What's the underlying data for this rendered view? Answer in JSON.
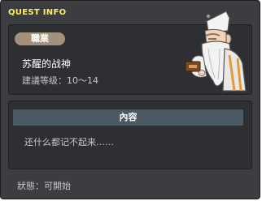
{
  "quest": {
    "id": "29924-0",
    "window_title": "QUEST INFO",
    "job_badge": "職業",
    "name": "苏醒的战神",
    "level_requirement": "建議等级：10～14",
    "content_header": "內容",
    "content_text": "还什么都记不起来……",
    "status": "狀態：可開始"
  },
  "colors": {
    "window_bg": "#3b3d40",
    "card_bg": "#2d2f33",
    "title": "#ffee66",
    "badge": "#a4917b",
    "content_header": "#4b5962"
  },
  "npc": {
    "icon": "elderly-sage-npc-icon"
  }
}
